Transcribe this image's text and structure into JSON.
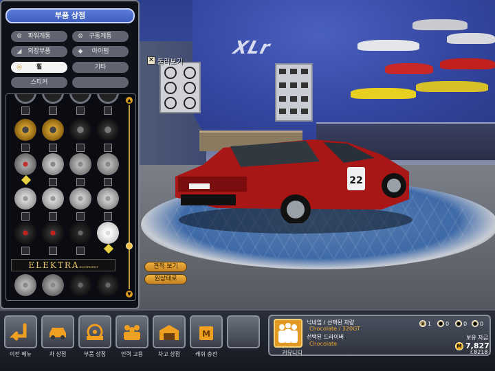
{
  "scene": {
    "logo_text": "XLr",
    "plate_number": "22"
  },
  "shop": {
    "title": "부품 상점",
    "categories": [
      {
        "label": "파워계통",
        "icon": "engine-icon",
        "active": false
      },
      {
        "label": "구동계통",
        "icon": "gear-icon",
        "active": false
      },
      {
        "label": "외장부품",
        "icon": "body-icon",
        "active": false
      },
      {
        "label": "아이템",
        "icon": "item-icon",
        "active": false
      },
      {
        "label": "휠",
        "icon": "wheel-icon",
        "active": true
      },
      {
        "label": "기타",
        "icon": "",
        "active": false
      },
      {
        "label": "스티커",
        "icon": "",
        "active": false
      },
      {
        "label": "",
        "icon": "",
        "active": false
      }
    ],
    "brand_banner": "ELEKTRA",
    "brand_banner_sub": "EQUIPMENT"
  },
  "rotate_toggle": {
    "label": "둘러보기",
    "checked": true
  },
  "buttons": {
    "estimate": "견적 보기",
    "reset": "원상태로"
  },
  "bottom_menu": [
    {
      "label": "이전 메뉴",
      "icon": "back-arrow-icon"
    },
    {
      "label": "차 상점",
      "icon": "car-shop-icon"
    },
    {
      "label": "부품 상점",
      "icon": "parts-shop-icon"
    },
    {
      "label": "인력 고용",
      "icon": "hire-staff-icon"
    },
    {
      "label": "차고 상점",
      "icon": "garage-shop-icon"
    },
    {
      "label": "캐쉬 충전",
      "icon": "cash-charge-icon"
    },
    {
      "label": "",
      "icon": ""
    }
  ],
  "info": {
    "nickname_label": "닉네임 / 선택된 차량",
    "nickname_value": "Chocolate / 320GT",
    "driver_label": "선택된 드라이버",
    "driver_value": "Chocolate",
    "stats": [
      "1",
      "0",
      "0",
      "0"
    ],
    "money_label": "보유 자금",
    "money_value": "7,827",
    "community_label": "커뮤니티",
    "version": "r.8218"
  },
  "colors": {
    "accent": "#e8a020",
    "title_blue": "#4a6ad0",
    "car_red": "#b01818"
  }
}
